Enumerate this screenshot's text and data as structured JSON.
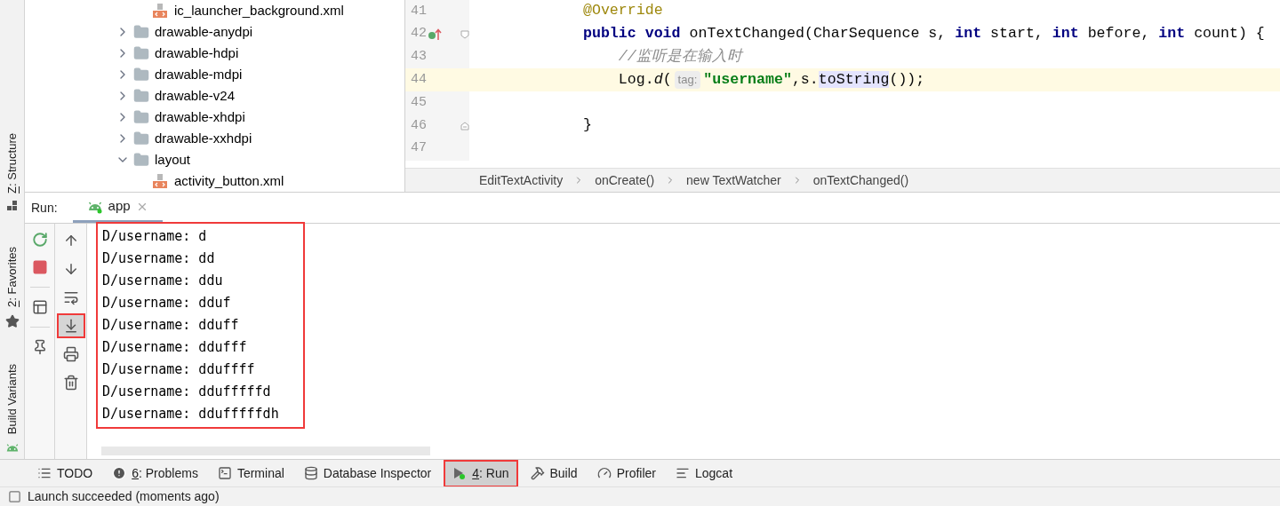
{
  "side_tabs": [
    {
      "label": "Z: Structure",
      "kind": "structure",
      "mnemonic": true
    },
    {
      "label": "2: Favorites",
      "kind": "favorites",
      "mnemonic": true
    },
    {
      "label": "Build Variants",
      "kind": "variants",
      "mnemonic": false
    }
  ],
  "tree": [
    {
      "kind": "folder",
      "expanded": true,
      "children": [
        {
          "kind": "file",
          "label": "ic_launcher_background.xml"
        }
      ]
    },
    {
      "kind": "folder",
      "label": "drawable-anydpi",
      "expanded": false
    },
    {
      "kind": "folder",
      "label": "drawable-hdpi",
      "expanded": false
    },
    {
      "kind": "folder",
      "label": "drawable-mdpi",
      "expanded": false
    },
    {
      "kind": "folder",
      "label": "drawable-v24",
      "expanded": false
    },
    {
      "kind": "folder",
      "label": "drawable-xhdpi",
      "expanded": false
    },
    {
      "kind": "folder",
      "label": "drawable-xxhdpi",
      "expanded": false
    },
    {
      "kind": "folder",
      "label": "layout",
      "expanded": true,
      "children": [
        {
          "kind": "file",
          "label": "activity_button.xml"
        }
      ]
    }
  ],
  "editor": {
    "lines": [
      {
        "number": "41",
        "highlighted": false,
        "tokens": [
          {
            "text": "@Override",
            "kind": "annotation"
          }
        ]
      },
      {
        "number": "42",
        "highlighted": false,
        "gutter": [
          {
            "kind": "override"
          },
          {
            "kind": "fold-start"
          }
        ],
        "tokens": [
          {
            "text": "public void",
            "kind": "keyword"
          },
          {
            "text": " onTextChanged(CharSequence s, ",
            "kind": "plain"
          },
          {
            "text": "int",
            "kind": "keyword"
          },
          {
            "text": " start, ",
            "kind": "plain"
          },
          {
            "text": "int",
            "kind": "keyword"
          },
          {
            "text": " before, ",
            "kind": "plain"
          },
          {
            "text": "int",
            "kind": "keyword"
          },
          {
            "text": " count) {",
            "kind": "plain"
          }
        ]
      },
      {
        "number": "43",
        "highlighted": false,
        "tokens": [
          {
            "text": "    //监听是在输入时",
            "kind": "comment"
          }
        ]
      },
      {
        "number": "44",
        "highlighted": true,
        "tokens": [
          {
            "text": "    Log.",
            "kind": "plain"
          },
          {
            "text": "d",
            "kind": "method"
          },
          {
            "text": "(",
            "kind": "plain"
          },
          {
            "text": "tag:",
            "kind": "hint"
          },
          {
            "text": "\"username\"",
            "kind": "string"
          },
          {
            "text": ",s.",
            "kind": "plain"
          },
          {
            "text": "toString",
            "kind": "usage"
          },
          {
            "text": "());",
            "kind": "plain"
          }
        ]
      },
      {
        "number": "45",
        "highlighted": false
      },
      {
        "number": "46",
        "highlighted": false,
        "gutter": [
          {
            "kind": "fold-end"
          }
        ],
        "tokens": [
          {
            "text": "}",
            "kind": "plain"
          }
        ]
      },
      {
        "number": "47",
        "highlighted": false
      }
    ],
    "breadcrumbs": [
      "EditTextActivity",
      "onCreate()",
      "new TextWatcher",
      "onTextChanged()"
    ]
  },
  "run": {
    "label": "Run:",
    "tab": {
      "label": "app",
      "selected": true
    },
    "toolbar_1": [
      {
        "kind": "rerun"
      },
      {
        "kind": "stop"
      },
      {
        "kind": "separator"
      },
      {
        "kind": "layout"
      },
      {
        "kind": "separator"
      },
      {
        "kind": "pin"
      }
    ],
    "toolbar_2": [
      {
        "kind": "up",
        "selected": false,
        "annotated": false
      },
      {
        "kind": "down",
        "selected": false,
        "annotated": false
      },
      {
        "kind": "wrap",
        "selected": false,
        "annotated": false
      },
      {
        "kind": "scroll-end",
        "selected": true,
        "annotated": true
      },
      {
        "kind": "print",
        "selected": false,
        "annotated": false
      },
      {
        "kind": "trash",
        "selected": false,
        "annotated": false
      }
    ],
    "console": {
      "annotated": true,
      "lines": [
        "D/username: d",
        "D/username: dd",
        "D/username: ddu",
        "D/username: dduf",
        "D/username: dduff",
        "D/username: ddufff",
        "D/username: dduffff",
        "D/username: ddufffffd",
        "D/username: ddufffffdh"
      ]
    }
  },
  "tool_tabs": [
    {
      "label": "TODO",
      "kind": "todo",
      "mnemonic": false,
      "selected": false,
      "annotated": false
    },
    {
      "label": "6: Problems",
      "kind": "problems",
      "mnemonic": true,
      "selected": false,
      "annotated": false
    },
    {
      "label": "Terminal",
      "kind": "terminal",
      "mnemonic": false,
      "selected": false,
      "annotated": false
    },
    {
      "label": "Database Inspector",
      "kind": "database",
      "mnemonic": false,
      "selected": false,
      "annotated": false
    },
    {
      "label": "4: Run",
      "kind": "run",
      "mnemonic": true,
      "selected": true,
      "annotated": true
    },
    {
      "label": "Build",
      "kind": "build",
      "mnemonic": false,
      "selected": false,
      "annotated": false
    },
    {
      "label": "Profiler",
      "kind": "profiler",
      "mnemonic": false,
      "selected": false,
      "annotated": false
    },
    {
      "label": "Logcat",
      "kind": "logcat",
      "mnemonic": false,
      "selected": false,
      "annotated": false
    }
  ],
  "status_bar": {
    "text": "Launch succeeded (moments ago)"
  }
}
